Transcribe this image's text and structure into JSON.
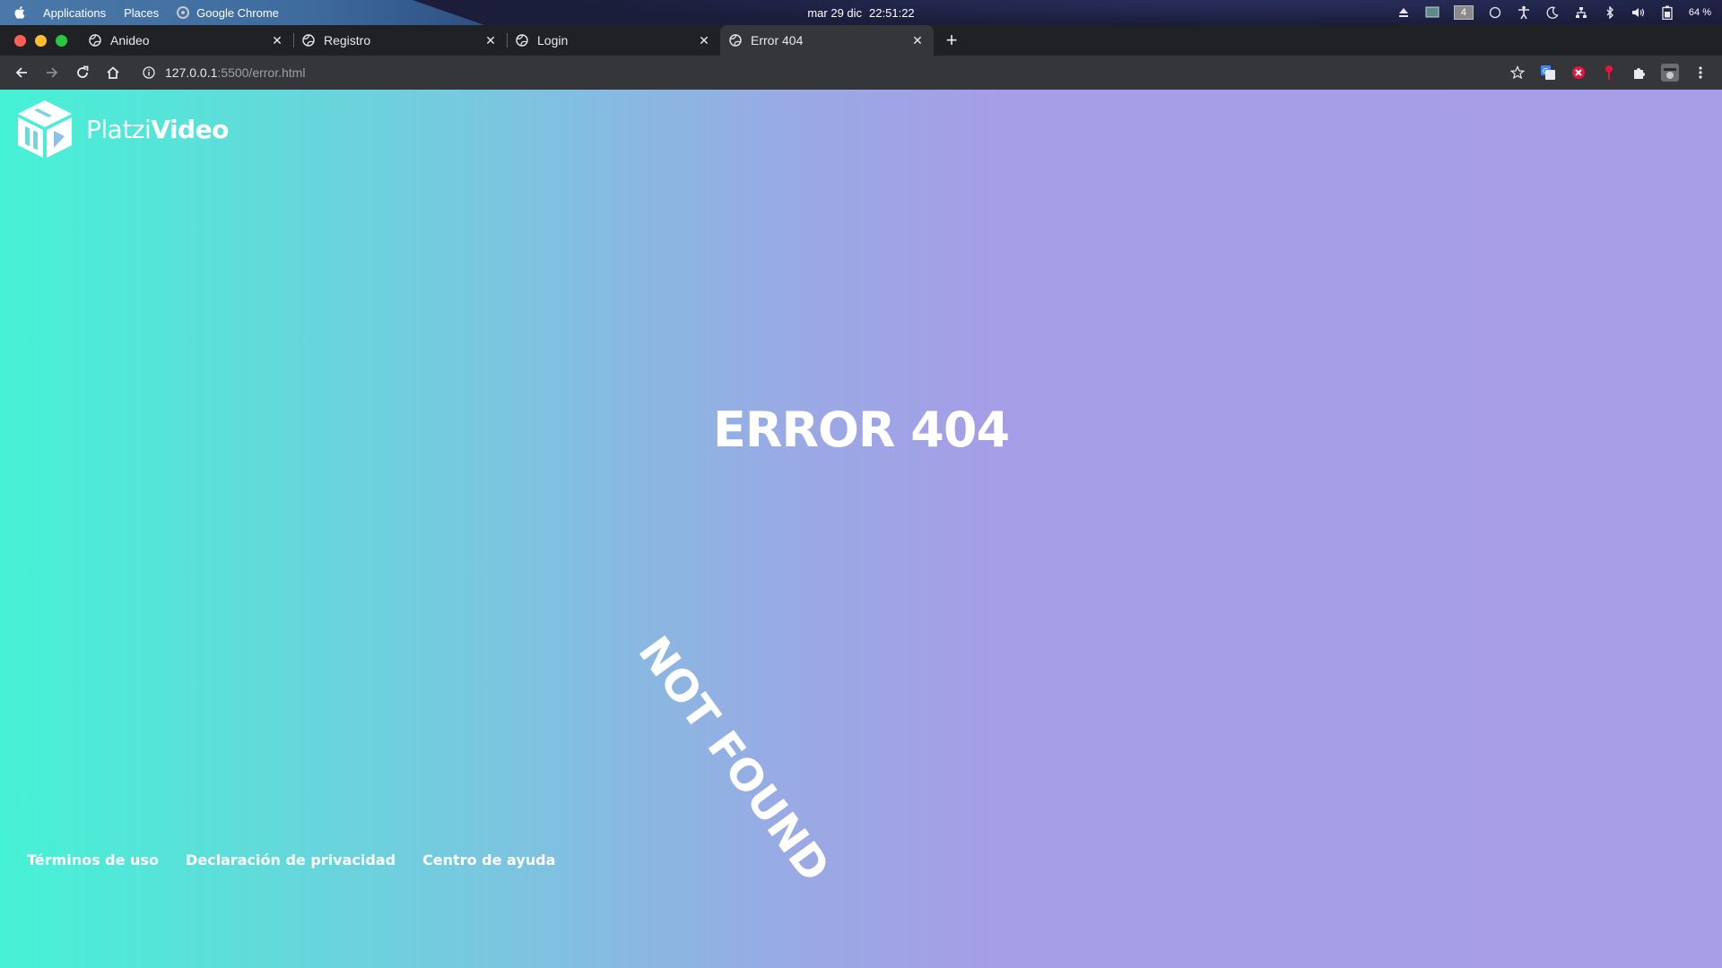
{
  "system_panel": {
    "menu_items": [
      "Applications",
      "Places"
    ],
    "active_app": "Google Chrome",
    "date": "mar 29 dic",
    "time": "22:51:22",
    "workspace": "4",
    "battery": "64 %",
    "tray_icons": [
      "eject-icon",
      "screen-icon",
      "workspace-indicator",
      "circle-icon",
      "accessibility-icon",
      "moon-icon",
      "network-icon",
      "bluetooth-icon",
      "volume-icon",
      "battery-icon"
    ]
  },
  "browser": {
    "tabs": [
      {
        "title": "Anideo",
        "active": false
      },
      {
        "title": "Registro",
        "active": false
      },
      {
        "title": "Login",
        "active": false
      },
      {
        "title": "Error 404",
        "active": true
      }
    ],
    "url_host": "127.0.0.1",
    "url_path": ":5500/error.html",
    "traffic_colors": {
      "close": "#ff5f57",
      "minimize": "#febc2e",
      "maximize": "#28c840"
    }
  },
  "page": {
    "brand_light": "Platzi",
    "brand_bold": "Video",
    "error_title": "ERROR 404",
    "rotated_text": "NOT FOUND",
    "footer_links": [
      "Términos de uso",
      "Declaración de privacidad",
      "Centro de ayuda"
    ],
    "gradient": {
      "start": "#45f2d5",
      "end": "#a79de7"
    }
  }
}
